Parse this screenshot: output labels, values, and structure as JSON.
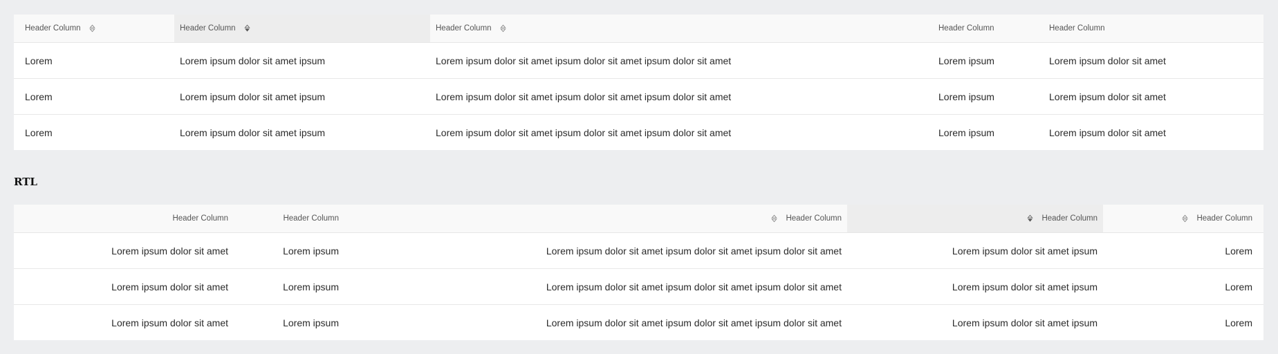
{
  "ltr_table": {
    "headers": [
      "Header Column",
      "Header Column",
      "Header Column",
      "Header Column",
      "Header Column"
    ],
    "rows": [
      [
        "Lorem",
        "Lorem ipsum dolor sit amet ipsum",
        "Lorem ipsum dolor sit amet ipsum dolor sit amet ipsum dolor sit amet",
        "Lorem ipsum",
        "Lorem ipsum dolor sit amet"
      ],
      [
        "Lorem",
        "Lorem ipsum dolor sit amet ipsum",
        "Lorem ipsum dolor sit amet ipsum dolor sit amet ipsum dolor sit amet",
        "Lorem ipsum",
        "Lorem ipsum dolor sit amet"
      ],
      [
        "Lorem",
        "Lorem ipsum dolor sit amet ipsum",
        "Lorem ipsum dolor sit amet ipsum dolor sit amet ipsum dolor sit amet",
        "Lorem ipsum",
        "Lorem ipsum dolor sit amet"
      ]
    ]
  },
  "rtl_section": {
    "title": "RTL"
  },
  "rtl_table": {
    "headers": [
      "Header Column",
      "Header Column",
      "Header Column",
      "Header Column",
      "Header Column"
    ],
    "rows": [
      [
        "Lorem",
        "Lorem ipsum dolor sit amet ipsum",
        "Lorem ipsum dolor sit amet ipsum dolor sit amet ipsum dolor sit amet",
        "Lorem ipsum",
        "Lorem ipsum dolor sit amet"
      ],
      [
        "Lorem",
        "Lorem ipsum dolor sit amet ipsum",
        "Lorem ipsum dolor sit amet ipsum dolor sit amet ipsum dolor sit amet",
        "Lorem ipsum",
        "Lorem ipsum dolor sit amet"
      ],
      [
        "Lorem",
        "Lorem ipsum dolor sit amet ipsum",
        "Lorem ipsum dolor sit amet ipsum dolor sit amet ipsum dolor sit amet",
        "Lorem ipsum",
        "Lorem ipsum dolor sit amet"
      ]
    ]
  },
  "icons": {
    "sortable": "sort-icon",
    "sorted": "sort-descending-icon"
  },
  "colors": {
    "background": "#edeef0",
    "header_bg": "#f9f9f9",
    "sorted_header_bg": "#ededed",
    "row_bg": "#ffffff"
  }
}
